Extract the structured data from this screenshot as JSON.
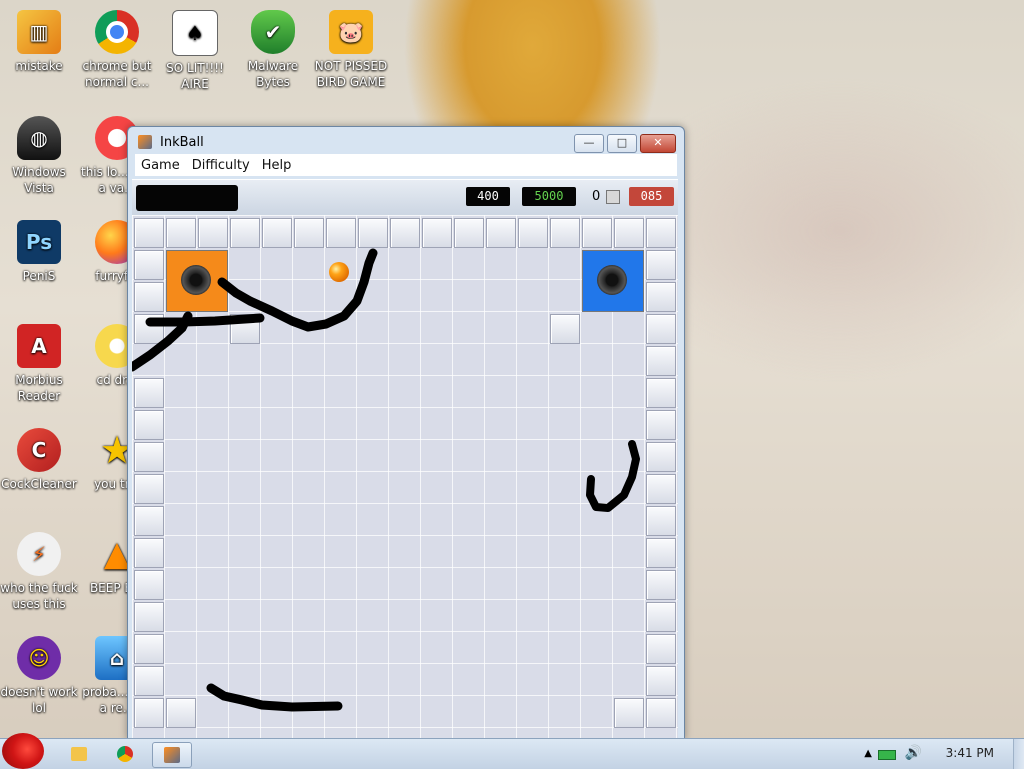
{
  "desktop": {
    "icons": [
      {
        "label": "mistake",
        "icon": "folder-photo-icon"
      },
      {
        "label": "chrome but normal c...",
        "icon": "chrome-icon"
      },
      {
        "label": "SO LIT!!!! AIRE",
        "icon": "card-icon"
      },
      {
        "label": "Malware Bytes",
        "icon": "shield-icon"
      },
      {
        "label": "NOT PISSED BIRD GAME",
        "icon": "bird-icon"
      },
      {
        "label": "Windows Vista",
        "icon": "bin-icon"
      },
      {
        "label": "this lo... like a va...",
        "icon": "opera-icon"
      },
      {
        "label": "PeniS",
        "icon": "photoshop-icon"
      },
      {
        "label": "furryf...",
        "icon": "firefox-icon"
      },
      {
        "label": "Morbius Reader",
        "icon": "pdf-icon"
      },
      {
        "label": "cd dr...",
        "icon": "cd-icon"
      },
      {
        "label": "CockCleaner",
        "icon": "cleaner-icon"
      },
      {
        "label": "you tr...",
        "icon": "star-icon"
      },
      {
        "label": "who the fuck uses this",
        "icon": "winamp-icon"
      },
      {
        "label": "BEEP B...",
        "icon": "vlc-icon"
      },
      {
        "label": "doesn't work lol",
        "icon": "yahoo-icon"
      },
      {
        "label": "proba... not a re...",
        "icon": "computer-icon"
      }
    ]
  },
  "window": {
    "title": "InkBall",
    "menu": [
      "Game",
      "Difficulty",
      "Help"
    ],
    "controls": {
      "minimize": "—",
      "maximize": "□",
      "close": "✕"
    }
  },
  "game": {
    "score_target": "400",
    "score_total": "5000",
    "balls_remaining": "0",
    "time_remaining": "085"
  },
  "taskbar": {
    "time": "3:41 PM"
  }
}
